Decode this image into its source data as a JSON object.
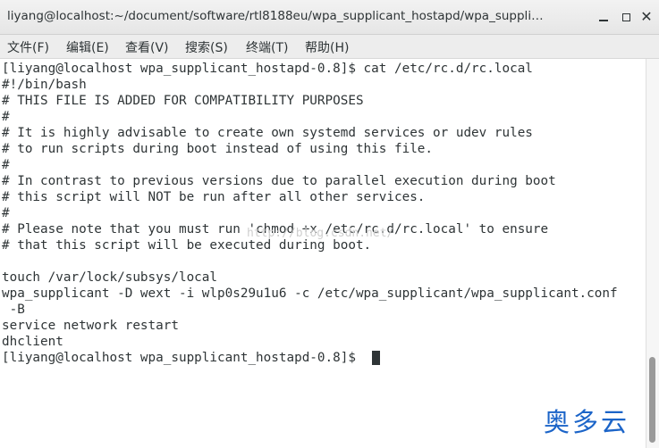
{
  "window": {
    "title": "liyang@localhost:~/document/software/rtl8188eu/wpa_supplicant_hostapd/wpa_suppli…",
    "minimize_icon": "minimize-icon",
    "maximize_icon": "maximize-icon",
    "close_icon": "close-icon",
    "close_glyph": "✕"
  },
  "menu": [
    {
      "label": "文件(F)"
    },
    {
      "label": "编辑(E)"
    },
    {
      "label": "查看(V)"
    },
    {
      "label": "搜索(S)"
    },
    {
      "label": "终端(T)"
    },
    {
      "label": "帮助(H)"
    }
  ],
  "terminal": {
    "lines": [
      "[liyang@localhost wpa_supplicant_hostapd-0.8]$ cat /etc/rc.d/rc.local",
      "#!/bin/bash",
      "# THIS FILE IS ADDED FOR COMPATIBILITY PURPOSES",
      "#",
      "# It is highly advisable to create own systemd services or udev rules",
      "# to run scripts during boot instead of using this file.",
      "#",
      "# In contrast to previous versions due to parallel execution during boot",
      "# this script will NOT be run after all other services.",
      "#",
      "# Please note that you must run 'chmod +x /etc/rc.d/rc.local' to ensure",
      "# that this script will be executed during boot.",
      "",
      "touch /var/lock/subsys/local",
      "wpa_supplicant -D wext -i wlp0s29u1u6 -c /etc/wpa_supplicant/wpa_supplicant.conf",
      " -B",
      "service network restart",
      "dhclient",
      "[liyang@localhost wpa_supplicant_hostapd-0.8]$ "
    ],
    "watermark": "http://blog.csdn.net/"
  },
  "logo": {
    "text": "奥多云"
  }
}
